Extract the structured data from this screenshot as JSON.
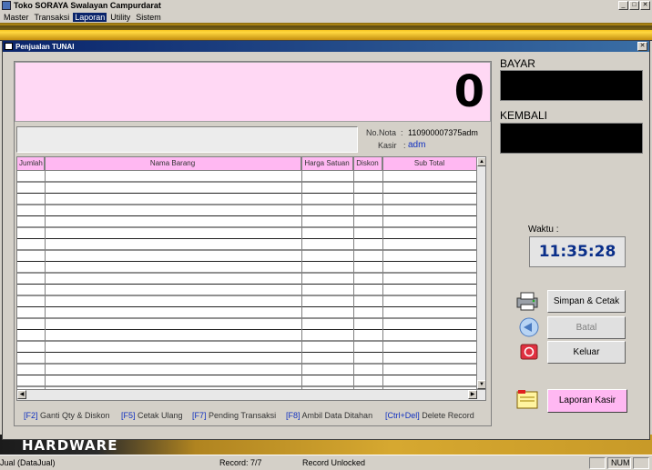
{
  "app": {
    "title": "Toko SORAYA Swalayan Campurdarat"
  },
  "window_buttons": [
    "_",
    "□",
    "✕"
  ],
  "menu": [
    {
      "label": "Master"
    },
    {
      "label": "Transaksi"
    },
    {
      "label": "Laporan"
    },
    {
      "label": "Utility"
    },
    {
      "label": "Sistem"
    }
  ],
  "child": {
    "title": "Penjualan TUNAI",
    "close": "✕"
  },
  "total": {
    "value": "0"
  },
  "nota": {
    "label": "No.Nota",
    "sep": ":",
    "value": "110900007375adm"
  },
  "kasir": {
    "label": "Kasir",
    "sep": ":",
    "value": "adm"
  },
  "grid": {
    "columns": [
      "Jumlah",
      "Nama Barang",
      "Harga Satuan",
      "Diskon",
      "Sub Total"
    ]
  },
  "shortcuts": [
    {
      "key": "[F2]",
      "text": "Ganti Qty  & Diskon"
    },
    {
      "key": "[F5]",
      "text": "Cetak Ulang"
    },
    {
      "key": "[F7]",
      "text": "Pending Transaksi"
    },
    {
      "key": "[F8]",
      "text": "Ambil Data Ditahan"
    },
    {
      "key": "[Ctrl+Del]",
      "text": "Delete Record"
    }
  ],
  "side": {
    "bayar_label": "BAYAR",
    "kembali_label": "KEMBALI",
    "waktu_label": "Waktu :",
    "time": "11:35:28"
  },
  "buttons": {
    "simpan": "Simpan & Cetak",
    "batal": "Batal",
    "keluar": "Keluar",
    "laporan": "Laporan Kasir"
  },
  "backdrop": {
    "text": "HARDWARE"
  },
  "status": {
    "left": "Jual (DataJual)",
    "record": "Record: 7/7",
    "lock": "Record Unlocked",
    "num": "NUM"
  }
}
